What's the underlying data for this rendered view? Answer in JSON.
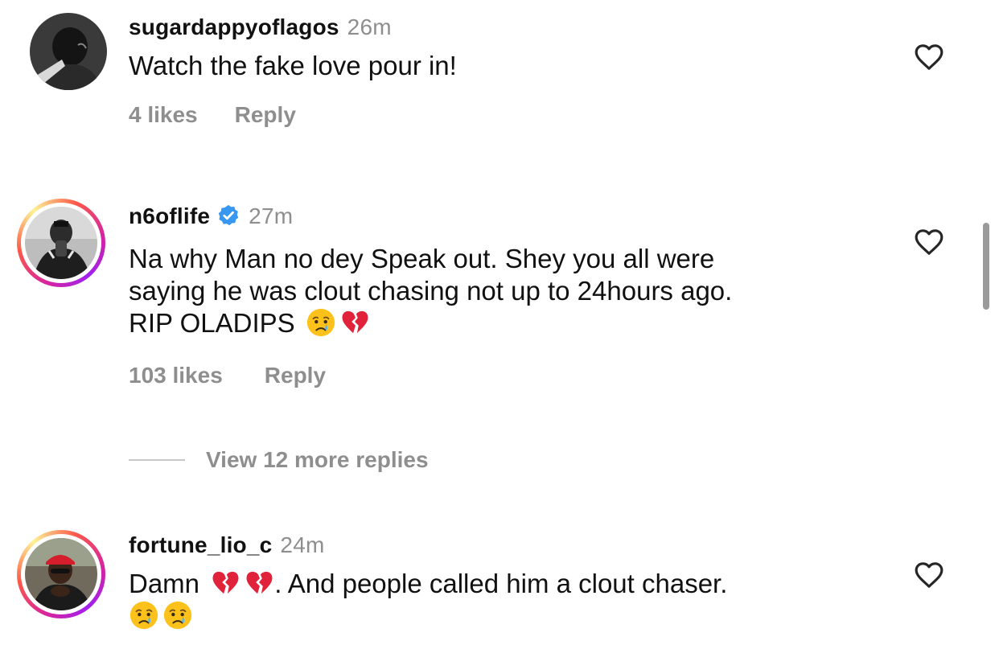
{
  "comments": [
    {
      "username": "sugardappyoflagos",
      "time": "26m",
      "verified": false,
      "text_lines": [
        "Watch the fake love pour in!"
      ],
      "likes": "4 likes",
      "reply": "Reply"
    },
    {
      "username": "n6oflife",
      "time": "27m",
      "verified": true,
      "text_lines": [
        "Na why Man no dey Speak out. Shey you all were",
        "saying he was clout chasing not up to 24hours ago.",
        "RIP  OLADIPS"
      ],
      "likes": "103 likes",
      "reply": "Reply"
    },
    {
      "username": "fortune_lio_c",
      "time": "24m",
      "verified": false,
      "text_lines": [
        "Damn",
        ". And people called him a clout chaser."
      ],
      "likes": "",
      "reply": ""
    }
  ],
  "view_more_replies": "View 12 more replies",
  "icons": {
    "heart": "heart-outline-icon",
    "verified": "verified-badge-icon",
    "crying": "crying-face-emoji",
    "broken_heart": "broken-heart-emoji"
  },
  "colors": {
    "muted": "#8e8e8e",
    "verified_blue": "#3897f0",
    "broken_heart_red": "#e0233a"
  }
}
